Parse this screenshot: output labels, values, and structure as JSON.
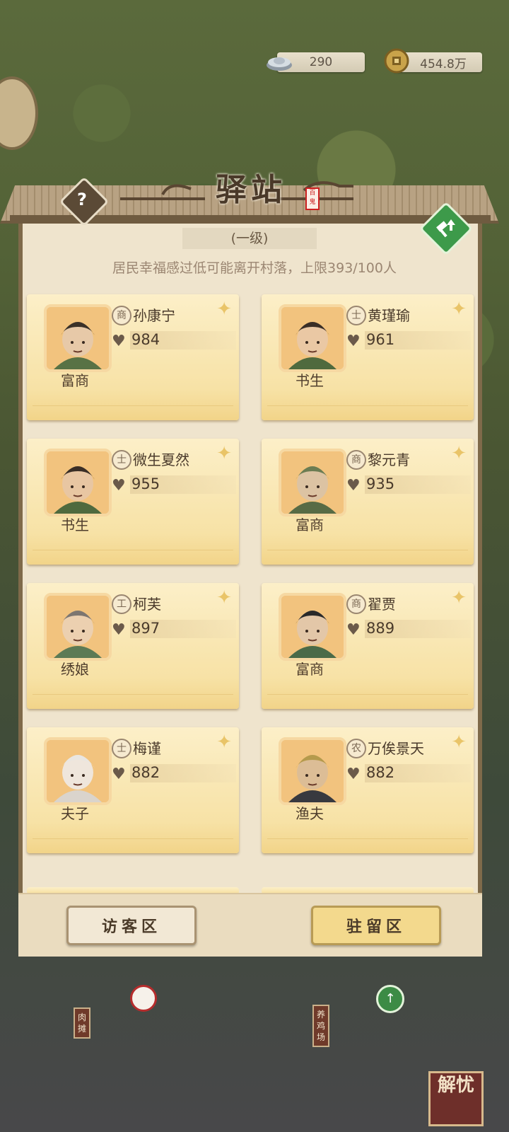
{
  "currency": {
    "silver": "290",
    "coins": "454.8万"
  },
  "header": {
    "title": "驿站",
    "seal": "百鬼",
    "help_label": "?",
    "level": "(一级)"
  },
  "notice": "居民幸福感过低可能离开村落，上限393/100人",
  "residents": [
    {
      "class": "商",
      "name": "孙康宁",
      "score": "984",
      "role": "富商"
    },
    {
      "class": "士",
      "name": "黄瑾瑜",
      "score": "961",
      "role": "书生"
    },
    {
      "class": "士",
      "name": "微生夏然",
      "score": "955",
      "role": "书生"
    },
    {
      "class": "商",
      "name": "黎元青",
      "score": "935",
      "role": "富商"
    },
    {
      "class": "工",
      "name": "柯芙",
      "score": "897",
      "role": "绣娘"
    },
    {
      "class": "商",
      "name": "翟贾",
      "score": "889",
      "role": "富商"
    },
    {
      "class": "士",
      "name": "梅谨",
      "score": "882",
      "role": "夫子"
    },
    {
      "class": "农",
      "name": "万俟景天",
      "score": "882",
      "role": "渔夫"
    }
  ],
  "buttons": {
    "visitor": "访客区",
    "stay": "驻留区"
  },
  "map": {
    "sign_meat": "肉摊",
    "sign_chicken": "养鸡场",
    "jieyou": "解忧"
  },
  "colors": {
    "card": "#f7e2a6",
    "panel": "#efe4cd",
    "upgrade": "#3d9a4a"
  }
}
